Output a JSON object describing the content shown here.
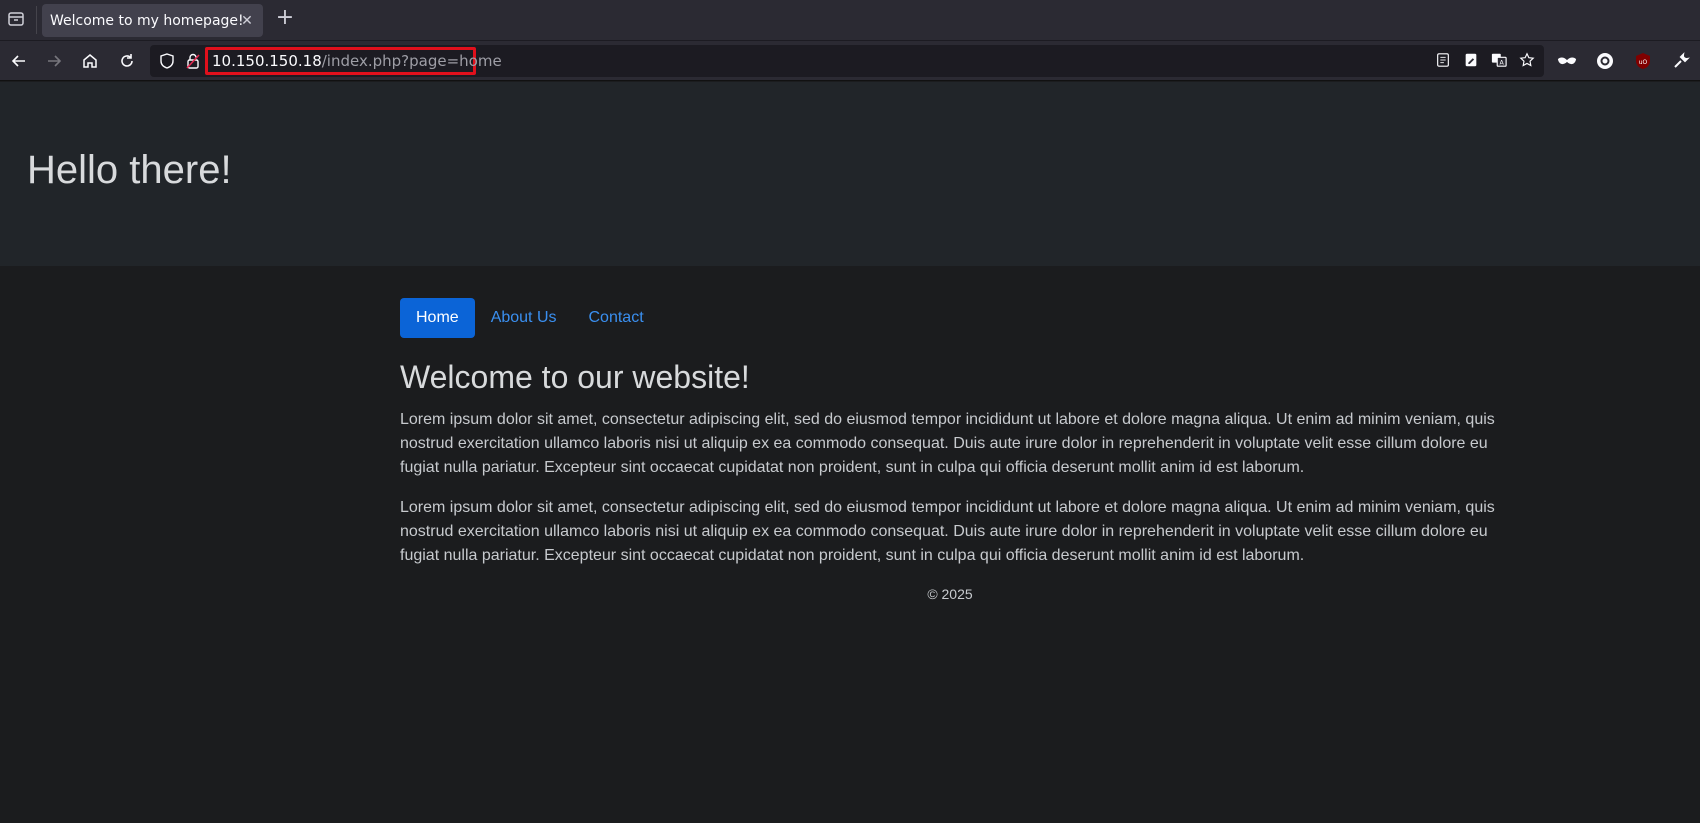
{
  "browser": {
    "tab": {
      "title": "Welcome to my homepage!"
    },
    "address_bar": {
      "host": "10.150.150.18",
      "path": "/index.php?page=home"
    }
  },
  "page": {
    "hero_title": "Hello there!",
    "nav": [
      {
        "label": "Home",
        "active": true
      },
      {
        "label": "About Us",
        "active": false
      },
      {
        "label": "Contact",
        "active": false
      }
    ],
    "content_title": "Welcome to our website!",
    "paragraphs": [
      "Lorem ipsum dolor sit amet, consectetur adipiscing elit, sed do eiusmod tempor incididunt ut labore et dolore magna aliqua. Ut enim ad minim veniam, quis nostrud exercitation ullamco laboris nisi ut aliquip ex ea commodo consequat. Duis aute irure dolor in reprehenderit in voluptate velit esse cillum dolore eu fugiat nulla pariatur. Excepteur sint occaecat cupidatat non proident, sunt in culpa qui officia deserunt mollit anim id est laborum.",
      "Lorem ipsum dolor sit amet, consectetur adipiscing elit, sed do eiusmod tempor incididunt ut labore et dolore magna aliqua. Ut enim ad minim veniam, quis nostrud exercitation ullamco laboris nisi ut aliquip ex ea commodo consequat. Duis aute irure dolor in reprehenderit in voluptate velit esse cillum dolore eu fugiat nulla pariatur. Excepteur sint occaecat cupidatat non proident, sunt in culpa qui officia deserunt mollit anim id est laborum."
    ],
    "footer": "© 2025"
  },
  "colors": {
    "nav_active_bg": "#0b64d7",
    "link": "#3a8ff0",
    "url_highlight": "#e0101c"
  }
}
